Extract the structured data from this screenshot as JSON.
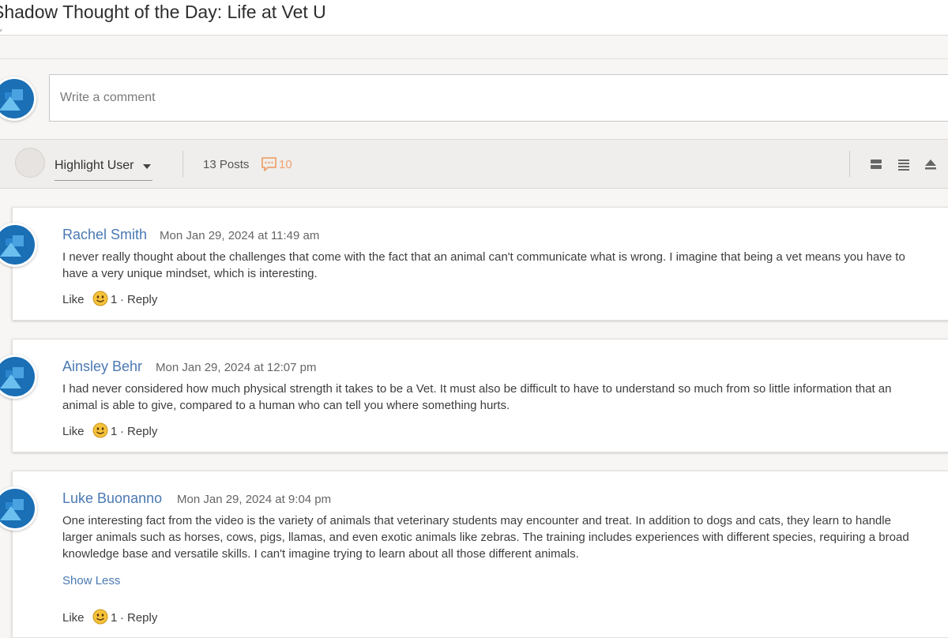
{
  "title": "Shadow Thought of the Day: Life at Vet U",
  "composer": {
    "placeholder": "Write a comment"
  },
  "toolbar": {
    "highlight_label": "Highlight User",
    "posts_label": "13 Posts",
    "replies_count": "10",
    "view_icons": [
      "collapse-view-icon",
      "list-view-icon",
      "expand-view-icon"
    ]
  },
  "colors": {
    "author_link": "#4a79b3",
    "reply_count": "#f0a26e",
    "avatar_blue": "#1a6fb5"
  },
  "comments": [
    {
      "author": "Rachel Smith",
      "date": "Mon Jan 29, 2024 at 11:49 am",
      "body": "I never really thought about the challenges that come with the fact that an animal can't communicate what is wrong. I imagine that being a vet means you have to have a very unique mindset, which is interesting.",
      "like_label": "Like",
      "like_count": "1",
      "separator": "·",
      "reply_label": "Reply"
    },
    {
      "author": "Ainsley Behr",
      "date": "Mon Jan 29, 2024 at 12:07 pm",
      "body": "I had never considered how much physical strength it takes to be a Vet. It must also be difficult to have to understand so much from so little information that an animal is able to give, compared to a human who can tell you where something hurts.",
      "like_label": "Like",
      "like_count": "1",
      "separator": "·",
      "reply_label": "Reply"
    },
    {
      "author": "Luke Buonanno",
      "date": "Mon Jan 29, 2024 at 9:04 pm",
      "body": "One interesting fact from the video is the variety of animals that veterinary students may encounter and treat. In addition to dogs and cats, they learn to handle larger animals such as horses, cows, pigs, llamas, and even exotic animals like zebras. The training includes experiences with different species, requiring a broad knowledge base and versatile skills. I can't imagine trying to learn about all those different animals.",
      "show_less_label": "Show Less",
      "like_label": "Like",
      "like_count": "1",
      "separator": "·",
      "reply_label": "Reply"
    }
  ]
}
